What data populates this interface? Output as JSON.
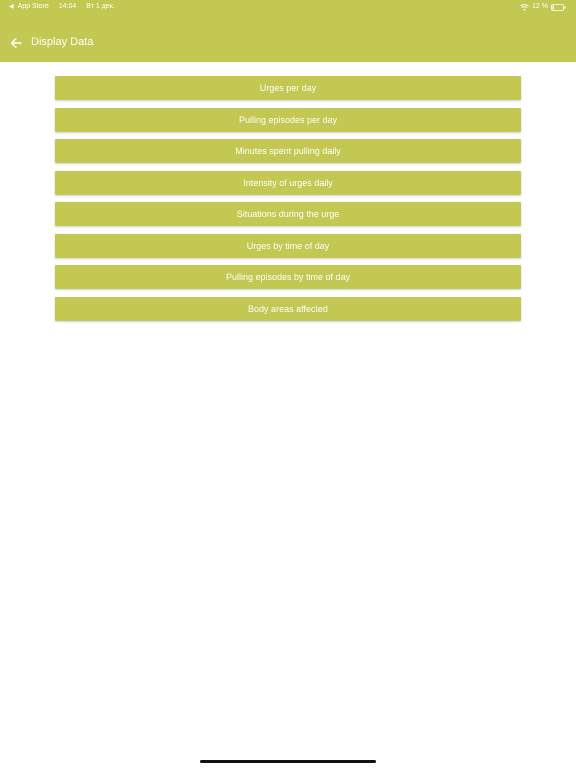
{
  "status_bar": {
    "back_app": "App Store",
    "time": "14:04",
    "date": "Вт 1 дек.",
    "battery": "12 %",
    "icons": [
      "wifi-icon",
      "battery-icon"
    ]
  },
  "nav": {
    "title": "Display Data",
    "back_icon": "arrow-left-icon"
  },
  "menu": {
    "items": [
      {
        "label": "Urges per day"
      },
      {
        "label": "Pulling episodes per day"
      },
      {
        "label": "Minutes spent pulling daily"
      },
      {
        "label": "Intensity of urges daily"
      },
      {
        "label": "Situations during the urge"
      },
      {
        "label": "Urges by time of day"
      },
      {
        "label": "Pulling episodes by time of day"
      },
      {
        "label": "Body areas affected"
      }
    ]
  },
  "colors": {
    "accent": "#c2c851",
    "text_on_accent": "#ffffff",
    "background": "#ffffff"
  }
}
